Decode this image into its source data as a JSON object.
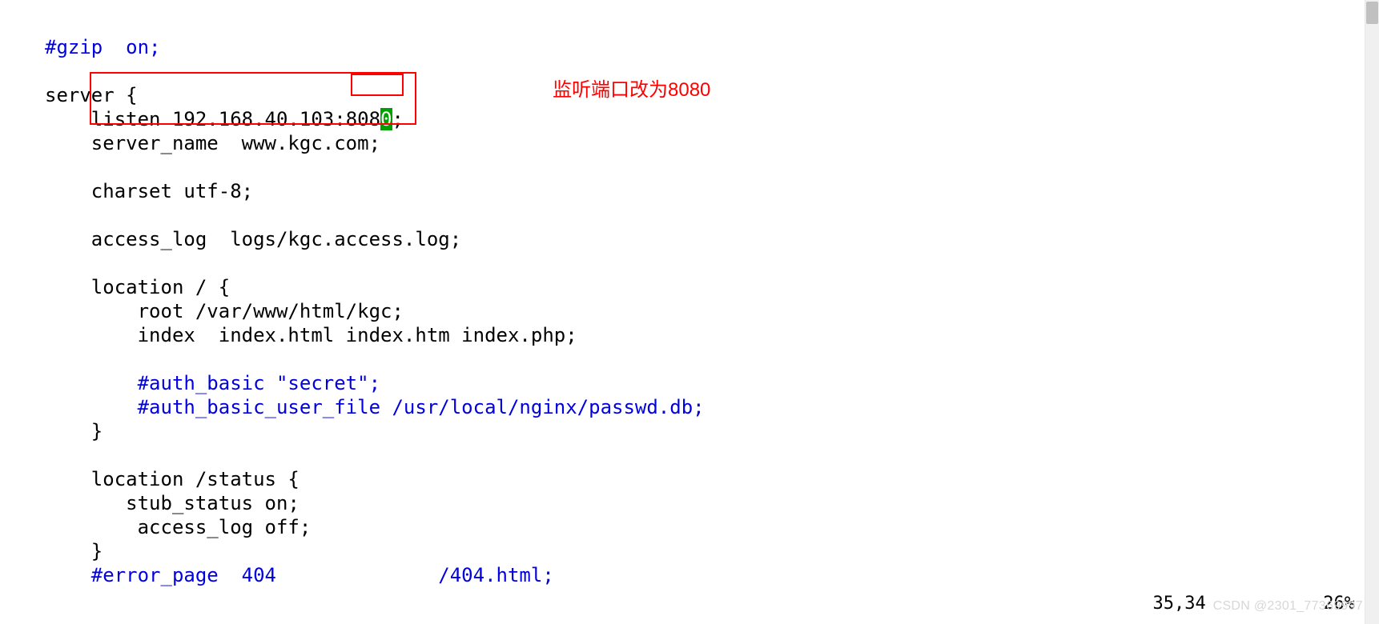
{
  "code": {
    "line1_comment": "#gzip  on;",
    "line3_server": "server {",
    "line4_listen_pre": "listen 192.168.40.103:",
    "line4_port_a": "808",
    "line4_port_cursor": "0",
    "line4_end": ";",
    "line5_server_name": "server_name  www.kgc.com;",
    "line7_charset": "charset utf-8;",
    "line9_access": "access_log  logs/kgc.access.log;",
    "line11_loc": "location / {",
    "line12_root": "root /var/www/html/kgc;",
    "line13_index": "index  index.html index.htm index.php;",
    "line15_auth1": "#auth_basic \"secret\";",
    "line16_auth2": "#auth_basic_user_file /usr/local/nginx/passwd.db;",
    "line17_close": "}",
    "line19_loc2": "location /status {",
    "line20_stub": "stub_status on;",
    "line21_acc": "access_log off;",
    "line22_close": "}",
    "line23_err": "#error_page  404              /404.html;"
  },
  "annotation": "监听端口改为8080",
  "status": {
    "pos": "35,34",
    "pct": "26%"
  },
  "watermark": "CSDN @2301_77369997"
}
